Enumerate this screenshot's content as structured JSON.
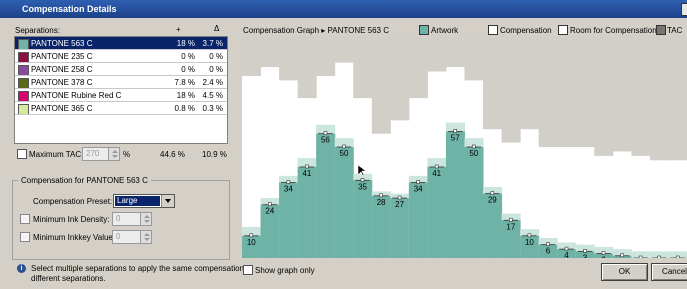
{
  "window": {
    "title": "Compensation Details"
  },
  "separations": {
    "header": "Separations:",
    "col_pct": "+",
    "col_delta": "Δ",
    "rows": [
      {
        "name": "PANTONE 563 C",
        "pct": "18 %",
        "delta": "3.7 %",
        "color": "#6fb3a6",
        "selected": true
      },
      {
        "name": "PANTONE 235 C",
        "pct": "0 %",
        "delta": "0 %",
        "color": "#8c1040"
      },
      {
        "name": "PANTONE 258 C",
        "pct": "0 %",
        "delta": "0 %",
        "color": "#8a4a9b"
      },
      {
        "name": "PANTONE 378 C",
        "pct": "7.8 %",
        "delta": "2.4 %",
        "color": "#5a6a1a"
      },
      {
        "name": "PANTONE Rubine Red C",
        "pct": "18 %",
        "delta": "4.5 %",
        "color": "#d6006e"
      },
      {
        "name": "PANTONE 365 C",
        "pct": "0.8 %",
        "delta": "0.3 %",
        "color": "#d3eb9c"
      }
    ]
  },
  "max_tac": {
    "label": "Maximum TAC:",
    "value": "270",
    "unit": "%",
    "total_pct": "44.6 %",
    "total_delta": "10.9 %"
  },
  "compensation": {
    "group_label": "Compensation for PANTONE 563 C",
    "preset_label": "Compensation Preset:",
    "preset_value": "Large",
    "min_density_label": "Minimum Ink Density:",
    "min_density_value": "0",
    "min_inkkey_label": "Minimum Inkkey Value:",
    "min_inkkey_value": "0"
  },
  "info_text_1": "Select multiple separations to apply the same compensation to",
  "info_text_2": "different separations.",
  "graph": {
    "breadcrumb": "Compensation Graph ▸ PANTONE 563 C",
    "legend": [
      {
        "label": "Artwork",
        "color": "#6fb3a6"
      },
      {
        "label": "Compensation",
        "color": "#ffffff"
      },
      {
        "label": "Room for Compensation",
        "color": "#ffffff"
      },
      {
        "label": "TAC",
        "color": "#7a7470"
      }
    ],
    "show_graph_only": "Show graph only"
  },
  "chart_data": {
    "type": "bar",
    "zones": 24,
    "artwork": [
      10,
      24,
      34,
      41,
      56,
      50,
      35,
      28,
      27,
      34,
      41,
      57,
      50,
      29,
      17,
      10,
      6,
      4,
      3,
      2,
      1,
      0,
      0,
      0
    ],
    "labels": [
      "10",
      "24",
      "34",
      "41",
      "56",
      "50",
      "35",
      "28",
      "27",
      "34",
      "41",
      "57",
      "50",
      "29",
      "17",
      "10",
      "6",
      "4",
      "3",
      "2",
      "1",
      "0",
      "0",
      "0"
    ],
    "compensation": [
      14,
      27,
      37,
      45,
      60,
      54,
      38,
      30,
      29,
      37,
      45,
      61,
      54,
      32,
      20,
      13,
      9,
      7,
      6,
      5,
      4,
      3,
      3,
      3
    ],
    "tac": [
      82,
      86,
      80,
      72,
      82,
      88,
      72,
      56,
      62,
      72,
      84,
      86,
      80,
      58,
      52,
      58,
      50,
      50,
      50,
      46,
      48,
      46,
      44,
      44
    ],
    "ylim": [
      0,
      100
    ],
    "colors": {
      "artwork": "#6fb3a6",
      "compensation": "#cde5df",
      "tac": "#d2cfc8"
    }
  },
  "buttons": {
    "ok": "OK",
    "cancel": "Cancel"
  }
}
